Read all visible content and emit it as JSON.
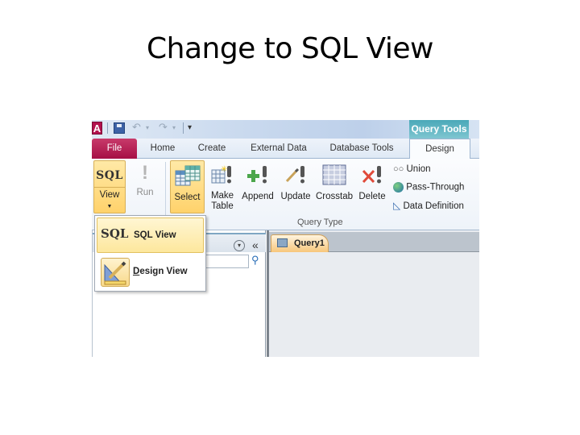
{
  "slide": {
    "title": "Change to SQL View"
  },
  "window": {
    "app_icon_letter": "A",
    "contextual_tab_group": "Query Tools",
    "accent_colors": {
      "file_tab": "#a60f45",
      "contextual": "#4aa8b8",
      "highlight": "#ffd26b"
    }
  },
  "tabs": [
    {
      "label": "File"
    },
    {
      "label": "Home"
    },
    {
      "label": "Create"
    },
    {
      "label": "External Data"
    },
    {
      "label": "Database Tools"
    },
    {
      "label": "Design",
      "active": true
    }
  ],
  "ribbon": {
    "view": {
      "glyph": "SQL",
      "label": "View"
    },
    "run": {
      "label": "Run"
    },
    "select": {
      "label": "Select"
    },
    "make_table": {
      "label_line1": "Make",
      "label_line2": "Table"
    },
    "append": {
      "label": "Append"
    },
    "update": {
      "label": "Update"
    },
    "crosstab": {
      "label": "Crosstab"
    },
    "delete": {
      "label": "Delete"
    },
    "union": {
      "label": "Union"
    },
    "pass_through": {
      "label": "Pass-Through"
    },
    "data_definition": {
      "label": "Data Definition"
    },
    "group_label": "Query Type"
  },
  "dropdown": {
    "items": [
      {
        "glyph": "SQL",
        "label": "SQL View",
        "mnemonic": "Q"
      },
      {
        "label_rest": "esign View",
        "mnemonic": "D"
      }
    ]
  },
  "nav_pane": {
    "collapse_glyph": "«",
    "menu_glyph": "▾",
    "search_placeholder": ""
  },
  "documents": {
    "tabs": [
      {
        "label": "Query1"
      }
    ]
  }
}
